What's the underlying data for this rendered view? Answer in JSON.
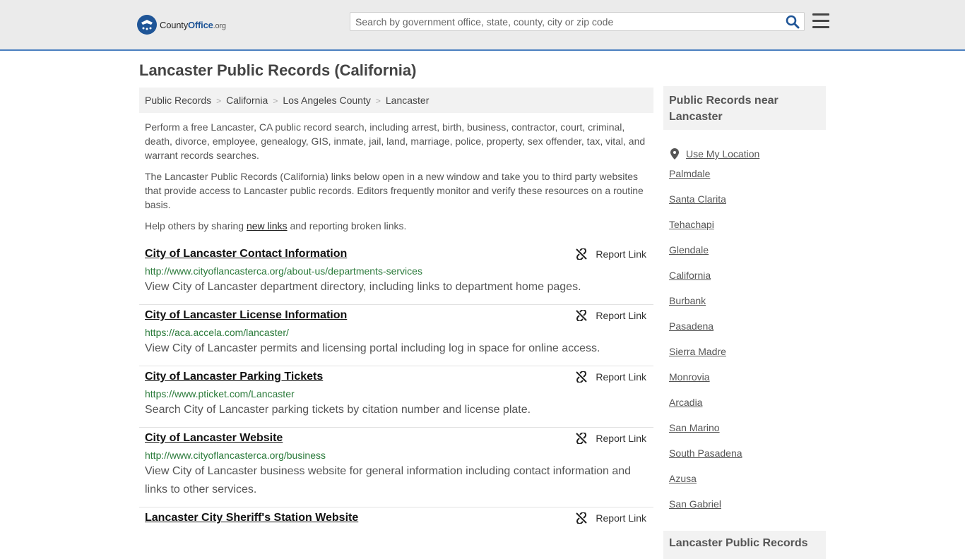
{
  "header": {
    "logo_text_main": "County",
    "logo_text_bold": "Office",
    "logo_text_suffix": ".org",
    "search_placeholder": "Search by government office, state, county, city or zip code",
    "search_icon": "search-icon",
    "menu_icon": "hamburger-menu-icon"
  },
  "page": {
    "title": "Lancaster Public Records (California)"
  },
  "breadcrumb": [
    "Public Records",
    "California",
    "Los Angeles County",
    "Lancaster"
  ],
  "intro": {
    "p1": "Perform a free Lancaster, CA public record search, including arrest, birth, business, contractor, court, criminal, death, divorce, employee, genealogy, GIS, inmate, jail, land, marriage, police, property, sex offender, tax, vital, and warrant records searches.",
    "p2": "The Lancaster Public Records (California) links below open in a new window and take you to third party websites that provide access to Lancaster public records. Editors frequently monitor and verify these resources on a routine basis.",
    "p3_before": "Help others by sharing ",
    "p3_link": "new links",
    "p3_after": " and reporting broken links."
  },
  "report_label": "Report Link",
  "records": [
    {
      "title": "City of Lancaster Contact Information",
      "url": "http://www.cityoflancasterca.org/about-us/departments-services",
      "desc": "View City of Lancaster department directory, including links to department home pages."
    },
    {
      "title": "City of Lancaster License Information",
      "url": "https://aca.accela.com/lancaster/",
      "desc": "View City of Lancaster permits and licensing portal including log in space for online access."
    },
    {
      "title": "City of Lancaster Parking Tickets",
      "url": "https://www.pticket.com/Lancaster",
      "desc": "Search City of Lancaster parking tickets by citation number and license plate."
    },
    {
      "title": "City of Lancaster Website",
      "url": "http://www.cityoflancasterca.org/business",
      "desc": "View City of Lancaster business website for general information including contact information and links to other services."
    },
    {
      "title": "Lancaster City Sheriff's Station Website",
      "url": "",
      "desc": ""
    }
  ],
  "sidebar": {
    "heading": "Public Records near Lancaster",
    "use_location": "Use My Location",
    "nearby": [
      "Palmdale",
      "Santa Clarita",
      "Tehachapi",
      "Glendale",
      "California",
      "Burbank",
      "Pasadena",
      "Sierra Madre",
      "Monrovia",
      "Arcadia",
      "San Marino",
      "South Pasadena",
      "Azusa",
      "San Gabriel"
    ],
    "heading2": "Lancaster Public Records"
  }
}
